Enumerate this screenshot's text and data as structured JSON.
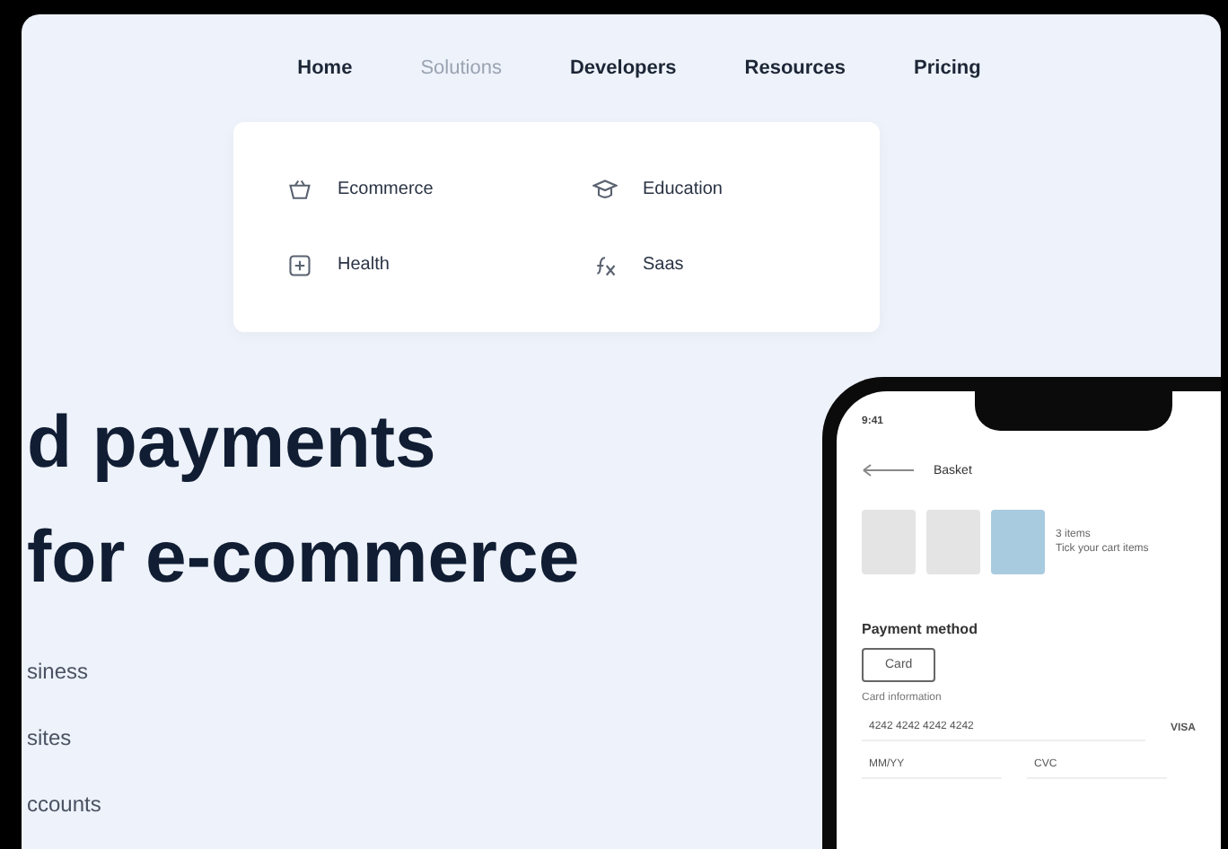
{
  "nav": [
    {
      "label": "Home",
      "selected": false
    },
    {
      "label": "Solutions",
      "selected": true
    },
    {
      "label": "Developers",
      "selected": false
    },
    {
      "label": "Resources",
      "selected": false
    },
    {
      "label": "Pricing",
      "selected": false
    }
  ],
  "solutions_menu": [
    {
      "label": "Ecommerce",
      "kind": "basket"
    },
    {
      "label": "Education",
      "kind": "cap"
    },
    {
      "label": "Health",
      "kind": "plus"
    },
    {
      "label": "Saas",
      "kind": "function"
    }
  ],
  "hero": {
    "headline": [
      "d payments",
      "for e-commerce"
    ],
    "lines": [
      "siness",
      "sites",
      "ccounts"
    ]
  },
  "phone": {
    "time": "9:41",
    "title": "Basket",
    "items_count": "3 items",
    "items_note": "Tick your cart items",
    "payment_label": "Payment method",
    "methods": [
      {
        "label": "Card",
        "selected": true
      }
    ],
    "card_label": "Card information",
    "card_number": "4242 4242 4242 4242",
    "card_brand": "VISA",
    "expiry": "MM/YY",
    "cvc": "CVC"
  }
}
